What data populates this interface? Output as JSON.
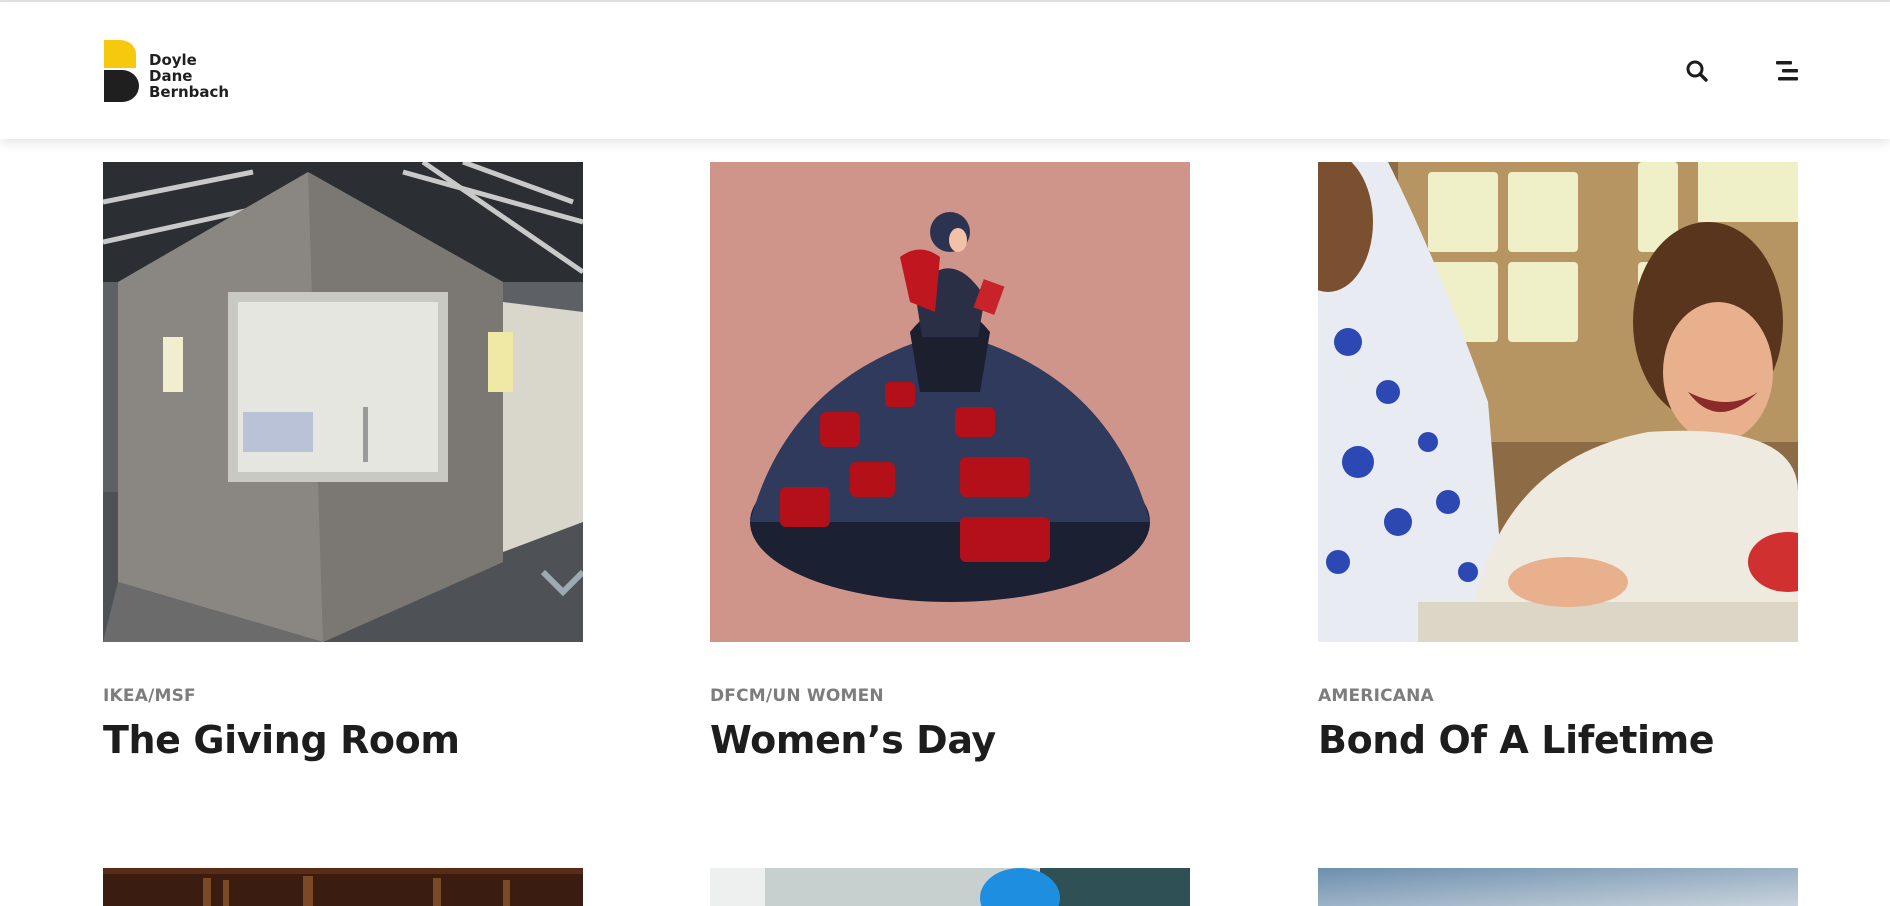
{
  "brand": {
    "name_lines": [
      "Doyle",
      "Dane",
      "Bernbach"
    ],
    "mark_color": "#f6c90e",
    "mark_dark": "#1f1f1f"
  },
  "header": {
    "search_icon": "search-icon",
    "menu_icon": "menu-icon"
  },
  "cards": [
    {
      "client": "IKEA/MSF",
      "title": "The Giving Room",
      "image": "giving-room-photo"
    },
    {
      "client": "DFCM/UN WOMEN",
      "title": "Women’s Day",
      "image": "womens-day-illustration",
      "bg": "#d0958a"
    },
    {
      "client": "AMERICANA",
      "title": "Bond Of A Lifetime",
      "image": "bond-of-a-lifetime-photo"
    }
  ],
  "next_row": [
    "library-photo",
    "blue-object-photo",
    "sky-photo"
  ]
}
